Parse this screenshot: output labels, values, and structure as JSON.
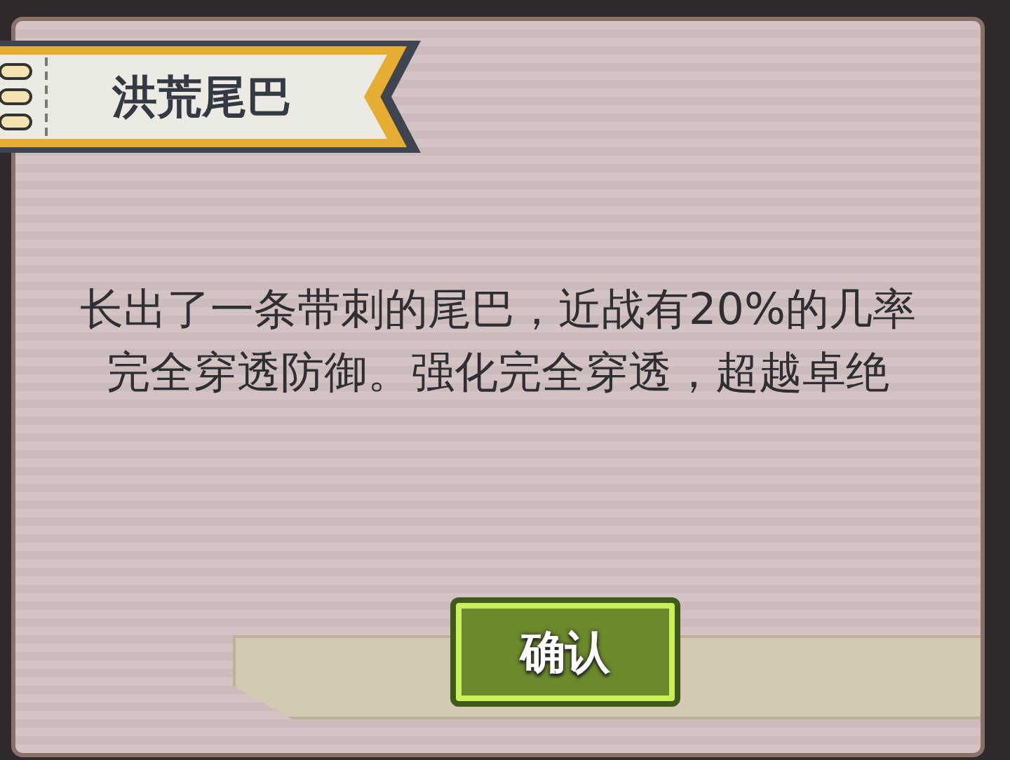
{
  "dialog": {
    "title": "洪荒尾巴",
    "description": "长出了一条带刺的尾巴，近战有20%的几率完全穿透防御。强化完全穿透，超越卓绝",
    "confirm_button": "确认"
  }
}
